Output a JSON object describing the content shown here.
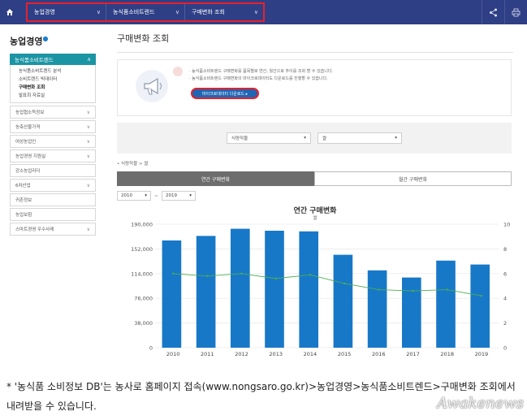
{
  "topnav": {
    "items": [
      {
        "label": "농업경영"
      },
      {
        "label": "농식품소비트렌드"
      },
      {
        "label": "구매변화 조회"
      }
    ]
  },
  "sidebar": {
    "title": "농업경영",
    "active_section": "농식품소비트렌드",
    "sub_items": [
      "농식품소비트렌드 분석",
      "소비트렌드 빅데이터",
      "구매변화 조회",
      "발표회 자료실"
    ],
    "items": [
      "농업협소득정보",
      "농축산물가격",
      "여성농업인",
      "농업경영 지원실",
      "강소농업리더",
      "6차산업",
      "귀촌정보",
      "농업보험",
      "스마트경영 우수사례"
    ]
  },
  "main": {
    "title": "구매변화 조회",
    "info_lines": [
      "· 농식품소비트렌드 구매변화를 품목별로 연간, 월간으로 추이를 조회 할 수 있습니다.",
      "· 농식품소비트렌드 구매변화의 마이크로데이터도 다운로드를 진행할 수 있습니다."
    ],
    "download_button": "마이크로데이터 다운로드 ▸",
    "filter": {
      "select1": "식량작물",
      "select2": "쌀"
    },
    "filter_note": "• 식량작물 > 쌀",
    "tabs": [
      "연간 구매변화",
      "월간 구매변화"
    ],
    "year_from": "2010",
    "year_to": "2019",
    "tilde": "~"
  },
  "chart_data": {
    "type": "bar",
    "title": "연간 구매변화",
    "subtitle": "쌀",
    "categories": [
      "2010",
      "2011",
      "2012",
      "2013",
      "2014",
      "2015",
      "2016",
      "2017",
      "2018",
      "2019"
    ],
    "series": [
      {
        "values": [
          165000,
          172000,
          183000,
          180000,
          179000,
          143000,
          119000,
          108000,
          134000,
          128000
        ],
        "kind": "bar",
        "axis": "left"
      },
      {
        "values": [
          6.0,
          5.8,
          6.0,
          5.6,
          5.9,
          5.2,
          4.7,
          4.6,
          4.7,
          4.2
        ],
        "kind": "line",
        "axis": "right"
      }
    ],
    "ylim_left": [
      0,
      190000
    ],
    "ylim_right": [
      0,
      10
    ],
    "yticks_left": [
      "0",
      "38,000",
      "76,000",
      "114,000",
      "152,000",
      "190,000"
    ],
    "yticks_right": [
      "0",
      "2",
      "4",
      "6",
      "8",
      "10"
    ],
    "colors": {
      "bar": "#1878c8",
      "line": "#4caf50"
    }
  },
  "caption": {
    "text": "* '농식품 소비정보 DB'는 농사로 홈페이지 접속(www.nongsaro.go.kr)>농업경영>농식품소비트렌드>구매변화 조회에서 내려받을 수 있습니다."
  },
  "watermark": {
    "text": "Awakenews"
  },
  "icons": [
    "home-icon",
    "share-icon",
    "print-icon",
    "megaphone-icon",
    "chevron-down-icon"
  ]
}
